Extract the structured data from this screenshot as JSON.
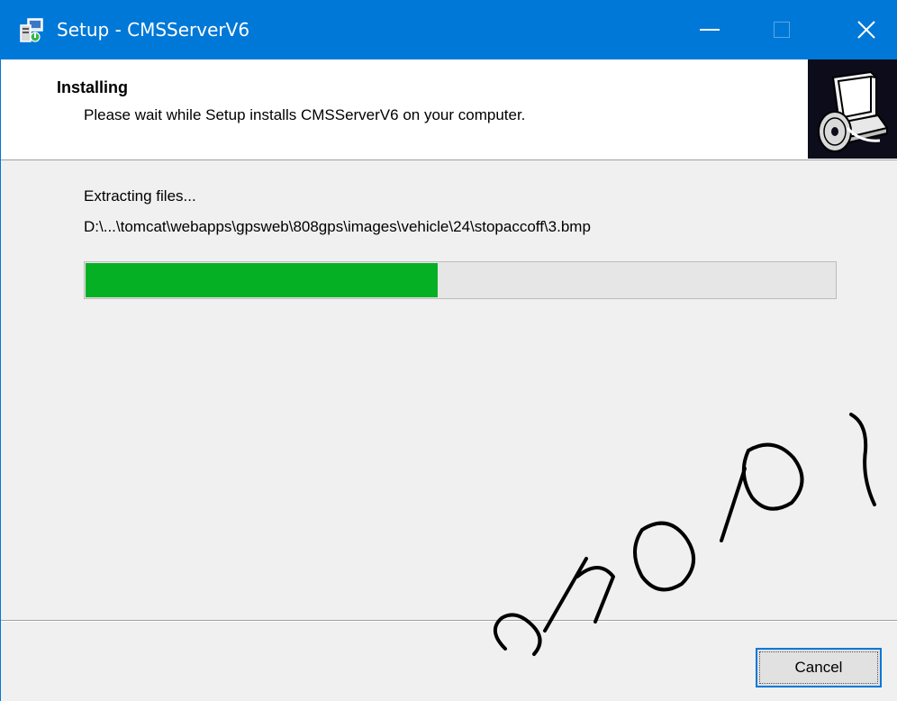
{
  "window": {
    "title": "Setup - CMSServerV6",
    "icons": {
      "app": "setup-app-icon",
      "minimize": "minimize-icon",
      "maximize": "maximize-icon",
      "close": "close-icon"
    }
  },
  "header": {
    "title": "Installing",
    "subtitle": "Please wait while Setup installs CMSServerV6 on your computer.",
    "image_icon": "computer-install-icon"
  },
  "main": {
    "status": "Extracting files...",
    "current_file": "D:\\...\\tomcat\\webapps\\gpsweb\\808gps\\images\\vehicle\\24\\stopaccoff\\3.bmp",
    "progress_fraction": 0.47
  },
  "footer": {
    "cancel_label": "Cancel"
  },
  "colors": {
    "titlebar": "#0078d7",
    "progress": "#06b025",
    "header_image_bg": "#0c0c1a"
  }
}
